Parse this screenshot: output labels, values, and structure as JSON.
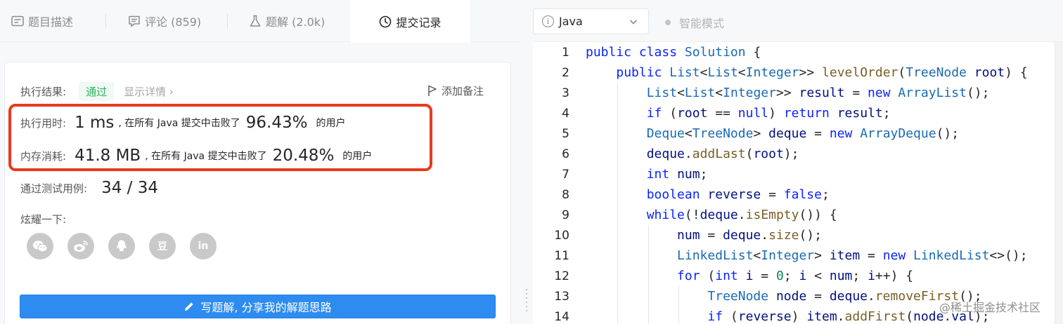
{
  "tabs": [
    {
      "label": "题目描述",
      "icon": "description-icon"
    },
    {
      "label": "评论 (859)",
      "icon": "comment-icon"
    },
    {
      "label": "题解 (2.0k)",
      "icon": "flask-icon"
    },
    {
      "label": "提交记录",
      "icon": "clock-icon",
      "active": true
    }
  ],
  "result": {
    "label": "执行结果:",
    "status": "通过",
    "detail": "显示详情 ›",
    "note": "添加备注"
  },
  "runtime": {
    "label": "执行用时:",
    "value": "1 ms",
    "mid": ", 在所有 Java 提交中击败了",
    "percent": "96.43%",
    "suffix": "的用户"
  },
  "memory": {
    "label": "内存消耗:",
    "value": "41.8 MB",
    "mid": ", 在所有 Java 提交中击败了",
    "percent": "20.48%",
    "suffix": "的用户"
  },
  "tests": {
    "label": "通过测试用例:",
    "value": "34 / 34"
  },
  "share": {
    "label": "炫耀一下:",
    "icons": [
      "wechat-icon",
      "weibo-icon",
      "qq-icon",
      "douban-icon",
      "linkedin-icon"
    ],
    "douban_glyph": "豆",
    "linkedin_glyph": "in"
  },
  "write_button": "写题解, 分享我的解题思路",
  "editor": {
    "language": "Java",
    "smart_mode": "智能模式",
    "lines": [
      "public class Solution {",
      "    public List<List<Integer>> levelOrder(TreeNode root) {",
      "        List<List<Integer>> result = new ArrayList();",
      "        if (root == null) return result;",
      "        Deque<TreeNode> deque = new ArrayDeque();",
      "        deque.addLast(root);",
      "        int num;",
      "        boolean reverse = false;",
      "        while(!deque.isEmpty()) {",
      "            num = deque.size();",
      "            LinkedList<Integer> item = new LinkedList<>();",
      "            for (int i = 0; i < num; i++) {",
      "                TreeNode node = deque.removeFirst();",
      "                if (reverse) item.addFirst(node.val);"
    ]
  },
  "watermark": "@稀土掘金技术社区",
  "colors": {
    "accent": "#2e8cf0",
    "success": "#2db55d",
    "highlight_box": "#e9391d",
    "keyword": "#0b24fb",
    "type": "#1a6ab5"
  }
}
